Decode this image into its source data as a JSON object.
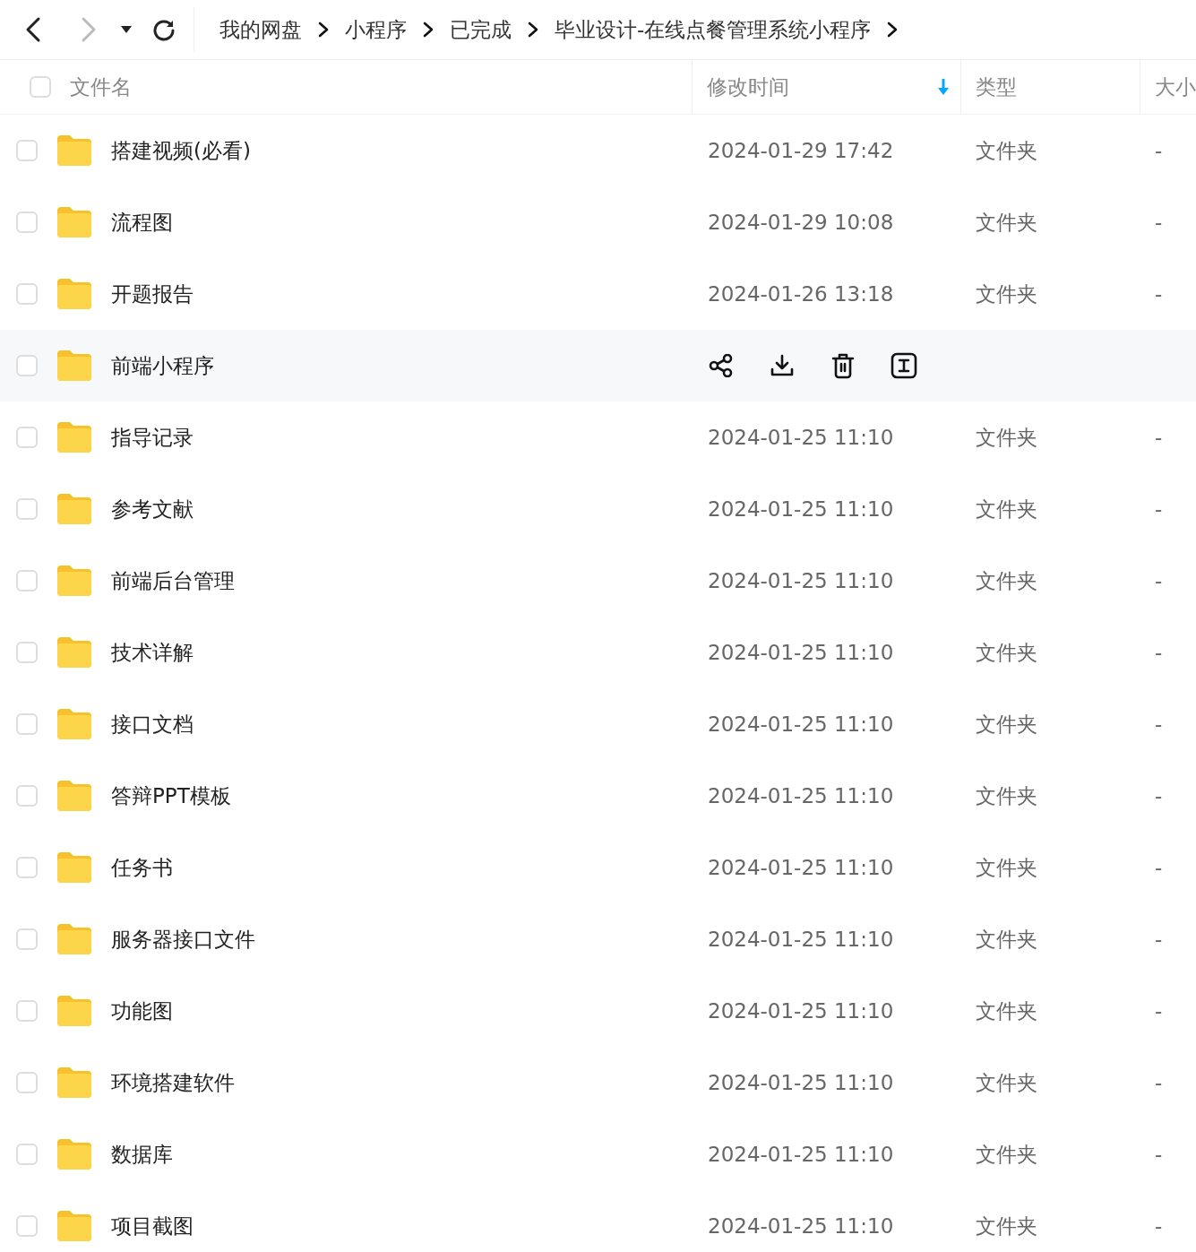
{
  "nav": {
    "back_disabled": false,
    "forward_disabled": true
  },
  "breadcrumb": [
    "我的网盘",
    "小程序",
    "已完成",
    "毕业设计-在线点餐管理系统小程序"
  ],
  "select_all": {
    "checked": false
  },
  "columns": [
    {
      "label": "文件名"
    },
    {
      "label": "修改时间",
      "sorted": true
    },
    {
      "label": "类型"
    },
    {
      "label": "大小"
    }
  ],
  "rows": [
    {
      "name": "搭建视频(必看)",
      "modified": "2024-01-29 17:42",
      "type": "文件夹",
      "size": "-",
      "checked": false,
      "hovered": false
    },
    {
      "name": "流程图",
      "modified": "2024-01-29 10:08",
      "type": "文件夹",
      "size": "-",
      "checked": false,
      "hovered": false
    },
    {
      "name": "开题报告",
      "modified": "2024-01-26 13:18",
      "type": "文件夹",
      "size": "-",
      "checked": false,
      "hovered": false
    },
    {
      "name": "前端小程序",
      "checked": false,
      "hovered": true
    },
    {
      "name": "指导记录",
      "modified": "2024-01-25 11:10",
      "type": "文件夹",
      "size": "-",
      "checked": false,
      "hovered": false
    },
    {
      "name": "参考文献",
      "modified": "2024-01-25 11:10",
      "type": "文件夹",
      "size": "-",
      "checked": false,
      "hovered": false
    },
    {
      "name": "前端后台管理",
      "modified": "2024-01-25 11:10",
      "type": "文件夹",
      "size": "-",
      "checked": false,
      "hovered": false
    },
    {
      "name": "技术详解",
      "modified": "2024-01-25 11:10",
      "type": "文件夹",
      "size": "-",
      "checked": false,
      "hovered": false
    },
    {
      "name": "接口文档",
      "modified": "2024-01-25 11:10",
      "type": "文件夹",
      "size": "-",
      "checked": false,
      "hovered": false
    },
    {
      "name": "答辩PPT模板",
      "modified": "2024-01-25 11:10",
      "type": "文件夹",
      "size": "-",
      "checked": false,
      "hovered": false
    },
    {
      "name": "任务书",
      "modified": "2024-01-25 11:10",
      "type": "文件夹",
      "size": "-",
      "checked": false,
      "hovered": false
    },
    {
      "name": "服务器接口文件",
      "modified": "2024-01-25 11:10",
      "type": "文件夹",
      "size": "-",
      "checked": false,
      "hovered": false
    },
    {
      "name": "功能图",
      "modified": "2024-01-25 11:10",
      "type": "文件夹",
      "size": "-",
      "checked": false,
      "hovered": false
    },
    {
      "name": "环境搭建软件",
      "modified": "2024-01-25 11:10",
      "type": "文件夹",
      "size": "-",
      "checked": false,
      "hovered": false
    },
    {
      "name": "数据库",
      "modified": "2024-01-25 11:10",
      "type": "文件夹",
      "size": "-",
      "checked": false,
      "hovered": false
    },
    {
      "name": "项目截图",
      "modified": "2024-01-25 11:10",
      "type": "文件夹",
      "size": "-",
      "checked": false,
      "hovered": false
    }
  ]
}
